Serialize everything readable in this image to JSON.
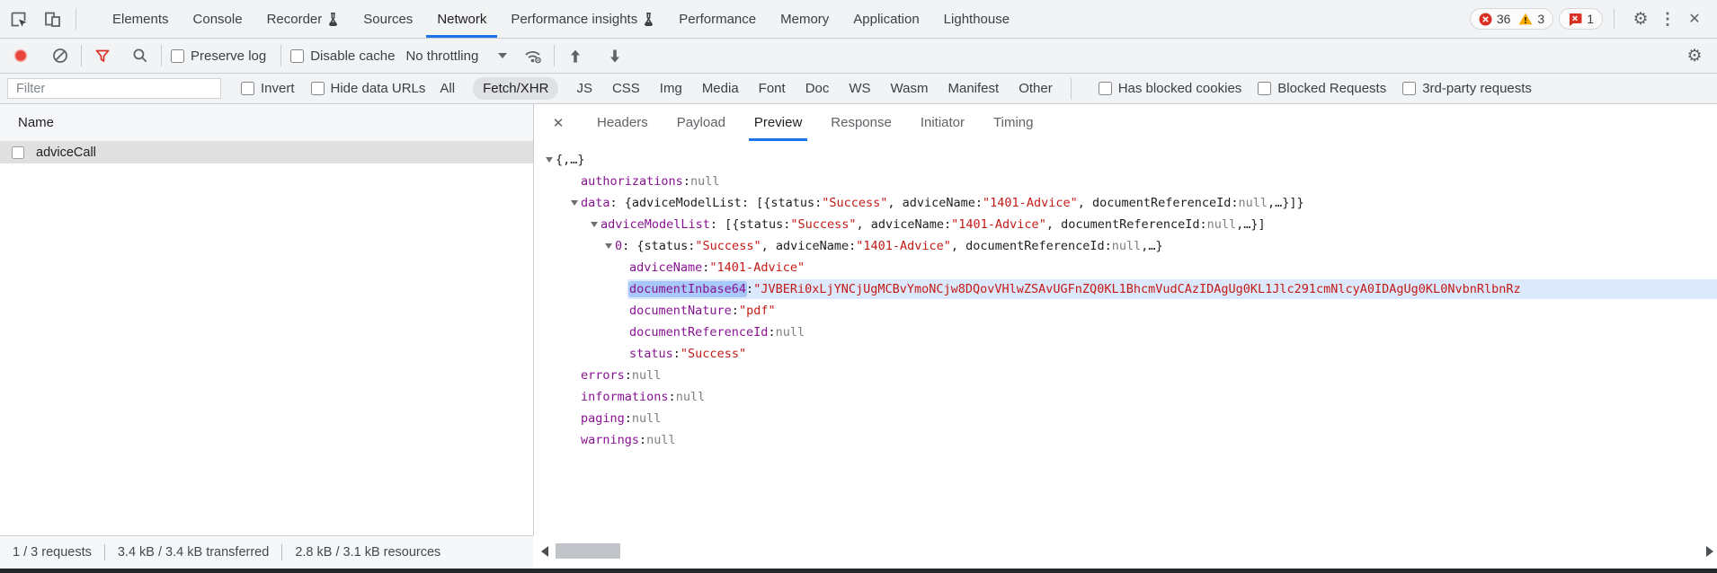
{
  "devtools": {
    "main_tabs": [
      {
        "label": "Elements",
        "flask": false,
        "active": false
      },
      {
        "label": "Console",
        "flask": false,
        "active": false
      },
      {
        "label": "Recorder",
        "flask": true,
        "active": false
      },
      {
        "label": "Sources",
        "flask": false,
        "active": false
      },
      {
        "label": "Network",
        "flask": false,
        "active": true
      },
      {
        "label": "Performance insights",
        "flask": true,
        "active": false
      },
      {
        "label": "Performance",
        "flask": false,
        "active": false
      },
      {
        "label": "Memory",
        "flask": false,
        "active": false
      },
      {
        "label": "Application",
        "flask": false,
        "active": false
      },
      {
        "label": "Lighthouse",
        "flask": false,
        "active": false
      }
    ],
    "badges": {
      "error_count": "36",
      "warning_count": "3",
      "issue_count": "1"
    },
    "toolbar": {
      "preserve_log_label": "Preserve log",
      "disable_cache_label": "Disable cache",
      "throttling_value": "No throttling"
    },
    "filter_bar": {
      "placeholder": "Filter",
      "invert_label": "Invert",
      "hide_data_urls_label": "Hide data URLs",
      "types": [
        {
          "label": "All",
          "active": false
        },
        {
          "label": "Fetch/XHR",
          "active": true
        },
        {
          "label": "JS",
          "active": false
        },
        {
          "label": "CSS",
          "active": false
        },
        {
          "label": "Img",
          "active": false
        },
        {
          "label": "Media",
          "active": false
        },
        {
          "label": "Font",
          "active": false
        },
        {
          "label": "Doc",
          "active": false
        },
        {
          "label": "WS",
          "active": false
        },
        {
          "label": "Wasm",
          "active": false
        },
        {
          "label": "Manifest",
          "active": false
        },
        {
          "label": "Other",
          "active": false
        }
      ],
      "has_blocked_cookies_label": "Has blocked cookies",
      "blocked_requests_label": "Blocked Requests",
      "third_party_label": "3rd-party requests"
    },
    "request_list": {
      "name_column": "Name",
      "rows": [
        {
          "name": "adviceCall",
          "selected": true
        }
      ]
    },
    "detail_tabs": [
      {
        "label": "Headers",
        "active": false
      },
      {
        "label": "Payload",
        "active": false
      },
      {
        "label": "Preview",
        "active": true
      },
      {
        "label": "Response",
        "active": false
      },
      {
        "label": "Initiator",
        "active": false
      },
      {
        "label": "Timing",
        "active": false
      }
    ],
    "preview_tree": {
      "lines": [
        {
          "indent": 0,
          "arrow": true,
          "segments": [
            {
              "t": "{,…}",
              "c": "plain"
            }
          ]
        },
        {
          "indent": 1,
          "arrow": false,
          "segments": [
            {
              "t": "authorizations",
              "c": "key"
            },
            {
              "t": ": ",
              "c": "plain"
            },
            {
              "t": "null",
              "c": "null"
            }
          ]
        },
        {
          "indent": 1,
          "arrow": true,
          "segments": [
            {
              "t": "data",
              "c": "key"
            },
            {
              "t": ": {adviceModelList: [{status: ",
              "c": "plain"
            },
            {
              "t": "\"Success\"",
              "c": "string"
            },
            {
              "t": ", adviceName: ",
              "c": "plain"
            },
            {
              "t": "\"1401-Advice\"",
              "c": "string"
            },
            {
              "t": ", documentReferenceId: ",
              "c": "plain"
            },
            {
              "t": "null",
              "c": "null"
            },
            {
              "t": ",…}]}",
              "c": "plain"
            }
          ]
        },
        {
          "indent": 2,
          "arrow": true,
          "segments": [
            {
              "t": "adviceModelList",
              "c": "key"
            },
            {
              "t": ": [{status: ",
              "c": "plain"
            },
            {
              "t": "\"Success\"",
              "c": "string"
            },
            {
              "t": ", adviceName: ",
              "c": "plain"
            },
            {
              "t": "\"1401-Advice\"",
              "c": "string"
            },
            {
              "t": ", documentReferenceId: ",
              "c": "plain"
            },
            {
              "t": "null",
              "c": "null"
            },
            {
              "t": ",…}]",
              "c": "plain"
            }
          ]
        },
        {
          "indent": 3,
          "arrow": true,
          "segments": [
            {
              "t": "0",
              "c": "key"
            },
            {
              "t": ": {status: ",
              "c": "plain"
            },
            {
              "t": "\"Success\"",
              "c": "string"
            },
            {
              "t": ", adviceName: ",
              "c": "plain"
            },
            {
              "t": "\"1401-Advice\"",
              "c": "string"
            },
            {
              "t": ", documentReferenceId: ",
              "c": "plain"
            },
            {
              "t": "null",
              "c": "null"
            },
            {
              "t": ",…}",
              "c": "plain"
            }
          ]
        },
        {
          "indent": 4,
          "arrow": false,
          "segments": [
            {
              "t": "adviceName",
              "c": "key"
            },
            {
              "t": ": ",
              "c": "plain"
            },
            {
              "t": "\"1401-Advice\"",
              "c": "string"
            }
          ]
        },
        {
          "indent": 4,
          "arrow": false,
          "highlight_row": true,
          "segments": [
            {
              "t": "documentInbase64",
              "c": "key",
              "hl": true
            },
            {
              "t": ": ",
              "c": "plain"
            },
            {
              "t": "\"JVBERi0xLjYNCjUgMCBvYmoNCjw8DQovVHlwZSAvUGFnZQ0KL1BhcmVudCAzIDAgUg0KL1Jlc291cmNlcyA0IDAgUg0KL0NvbnRlbnRz",
              "c": "string"
            }
          ]
        },
        {
          "indent": 4,
          "arrow": false,
          "segments": [
            {
              "t": "documentNature",
              "c": "key"
            },
            {
              "t": ": ",
              "c": "plain"
            },
            {
              "t": "\"pdf\"",
              "c": "string"
            }
          ]
        },
        {
          "indent": 4,
          "arrow": false,
          "segments": [
            {
              "t": "documentReferenceId",
              "c": "key"
            },
            {
              "t": ": ",
              "c": "plain"
            },
            {
              "t": "null",
              "c": "null"
            }
          ]
        },
        {
          "indent": 4,
          "arrow": false,
          "segments": [
            {
              "t": "status",
              "c": "key"
            },
            {
              "t": ": ",
              "c": "plain"
            },
            {
              "t": "\"Success\"",
              "c": "string"
            }
          ]
        },
        {
          "indent": 1,
          "arrow": false,
          "segments": [
            {
              "t": "errors",
              "c": "key"
            },
            {
              "t": ": ",
              "c": "plain"
            },
            {
              "t": "null",
              "c": "null"
            }
          ]
        },
        {
          "indent": 1,
          "arrow": false,
          "segments": [
            {
              "t": "informations",
              "c": "key"
            },
            {
              "t": ": ",
              "c": "plain"
            },
            {
              "t": "null",
              "c": "null"
            }
          ]
        },
        {
          "indent": 1,
          "arrow": false,
          "segments": [
            {
              "t": "paging",
              "c": "key"
            },
            {
              "t": ": ",
              "c": "plain"
            },
            {
              "t": "null",
              "c": "null"
            }
          ]
        },
        {
          "indent": 1,
          "arrow": false,
          "segments": [
            {
              "t": "warnings",
              "c": "key"
            },
            {
              "t": ": ",
              "c": "plain"
            },
            {
              "t": "null",
              "c": "null"
            }
          ]
        }
      ]
    },
    "status_bar": {
      "requests": "1 / 3 requests",
      "transferred": "3.4 kB / 3.4 kB transferred",
      "resources": "2.8 kB / 3.1 kB resources"
    },
    "colors": {
      "accent": "#1a73e8",
      "error": "#d93025",
      "warning": "#f9ab00",
      "key": "#881391",
      "string": "#c41a16"
    }
  }
}
